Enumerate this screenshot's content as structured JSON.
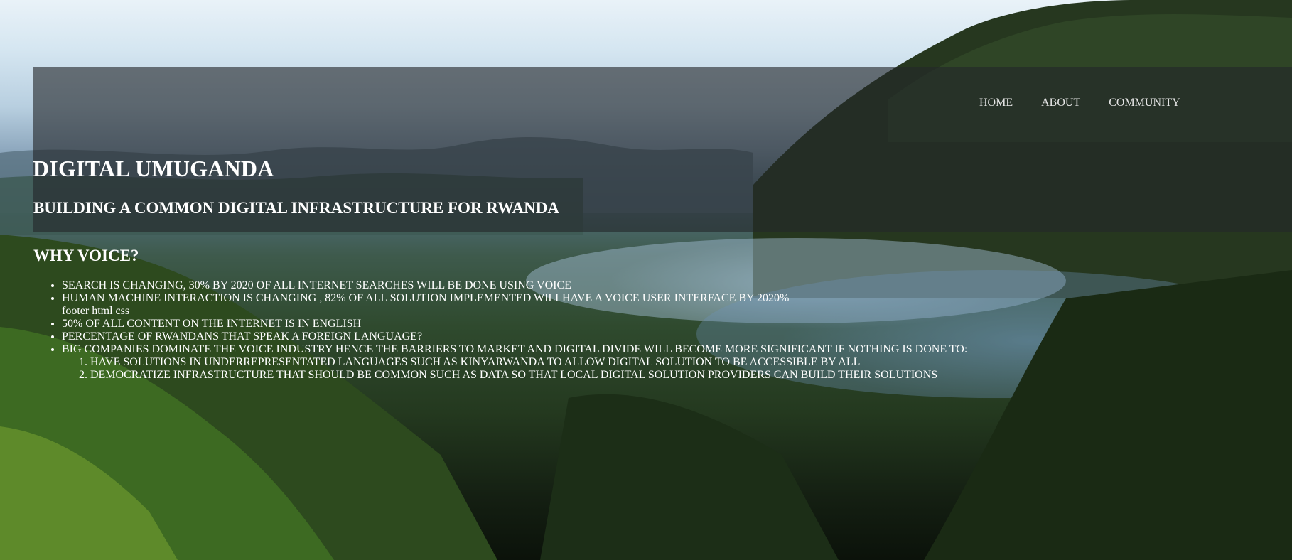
{
  "nav": {
    "items": [
      {
        "label": "HOME"
      },
      {
        "label": "ABOUT"
      },
      {
        "label": "COMMUNITY"
      }
    ]
  },
  "header": {
    "title": "DIGITAL UMUGANDA",
    "subtitle": "BUILDING A COMMON DIGITAL INFRASTRUCTURE FOR RWANDA"
  },
  "why_voice": {
    "title": "WHY VOICE?",
    "items": [
      {
        "text": "SEARCH IS CHANGING, 30% BY 2020 OF ALL INTERNET SEARCHES WILL BE DONE USING VOICE"
      },
      {
        "text": "HUMAN MACHINE INTERACTION IS CHANGING , 82% OF ALL SOLUTION IMPLEMENTED WILLHAVE A VOICE USER INTERFACE BY 2020%",
        "note": "footer html css"
      },
      {
        "text": "50% OF ALL CONTENT ON THE INTERNET IS IN ENGLISH"
      },
      {
        "text": "PERCENTAGE OF RWANDANS THAT SPEAK A FOREIGN LANGUAGE?"
      },
      {
        "text": "BIG COMPANIES DOMINATE THE VOICE INDUSTRY HENCE THE BARRIERS TO MARKET AND DIGITAL DIVIDE WILL BECOME MORE SIGNIFICANT IF NOTHING IS DONE TO:"
      }
    ],
    "sub_items": [
      {
        "text": "HAVE SOLUTIONS IN UNDERREPRESENTATED LANGUAGES SUCH AS KINYARWANDA TO ALLOW DIGITAL SOLUTION TO BE ACCESSIBLE BY ALL"
      },
      {
        "text": "DEMOCRATIZE INFRASTRUCTURE THAT SHOULD BE COMMON SUCH AS DATA SO THAT LOCAL DIGITAL SOLUTION PROVIDERS CAN BUILD THEIR SOLUTIONS"
      }
    ]
  },
  "colors": {
    "text": "#ffffff",
    "nav_text": "#e6e6e6",
    "header_overlay": "rgba(35, 38, 42, 0.62)"
  }
}
